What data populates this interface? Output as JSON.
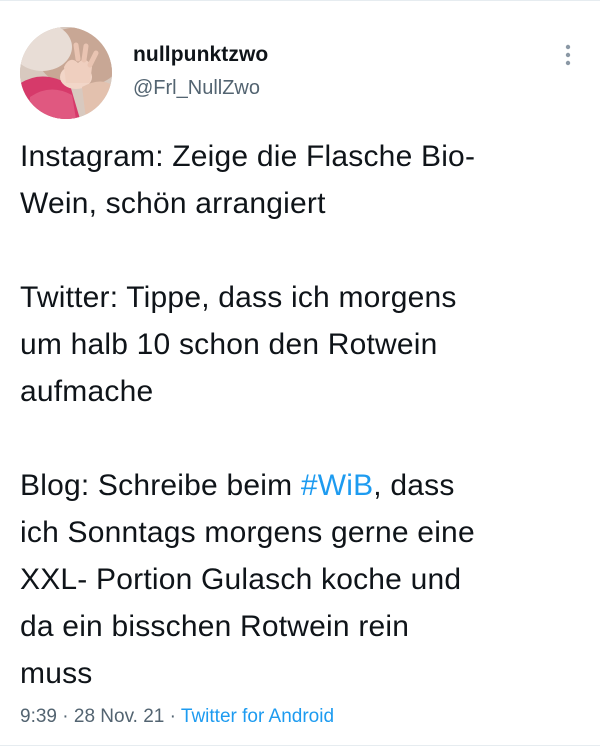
{
  "user": {
    "display_name": "nullpunktzwo",
    "handle": "@Frl_NullZwo"
  },
  "tweet": {
    "para1": "Instagram: Zeige die Flasche Bio-\nWein, schön arrangiert",
    "para2": "Twitter: Tippe, dass ich morgens\num halb 10 schon den Rotwein\naufmache",
    "para3_before": "Blog: Schreibe beim ",
    "hashtag": "#WiB",
    "para3_after": ", dass\nich Sonntags morgens gerne eine\nXXL- Portion Gulasch koche und\nda ein bisschen Rotwein rein\nmuss"
  },
  "meta": {
    "time": "9:39",
    "separator1": " · ",
    "date": "28 Nov. 21",
    "separator2": " · ",
    "source": "Twitter for Android"
  },
  "colors": {
    "link": "#1d9bf0",
    "secondary_text": "#536471",
    "primary_text": "#0f1419"
  },
  "icons": {
    "more": "more-vertical-icon",
    "avatar": "avatar-image"
  }
}
